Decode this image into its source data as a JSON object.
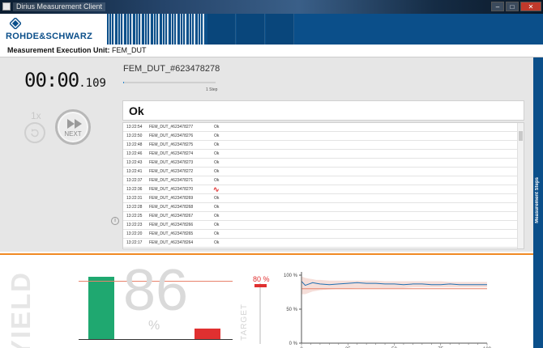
{
  "window": {
    "title": "Dirius Measurement Client",
    "minimize_glyph": "–",
    "maximize_glyph": "□",
    "close_glyph": "✕"
  },
  "header": {
    "brand": "ROHDE&SCHWARZ",
    "brand_color": "#0b4f8a"
  },
  "unit_bar": {
    "label": "Measurement Execution Unit:",
    "value": "FEM_DUT"
  },
  "timer": {
    "main": "00:00",
    "ms": ".109"
  },
  "controls": {
    "run_count": "1x",
    "next_label": "NEXT",
    "repeat_icon": "repeat-icon",
    "next_icon": "fast-forward-icon"
  },
  "current": {
    "dut_title": "FEM_DUT_#623478278",
    "progress": 0.0,
    "step_label": "1 Step",
    "status": "Ok"
  },
  "results": [
    {
      "time": "13:22:54",
      "dut": "FEM_DUT_#623478277",
      "status": "Ok",
      "fail": false
    },
    {
      "time": "13:22:50",
      "dut": "FEM_DUT_#623478276",
      "status": "Ok",
      "fail": false
    },
    {
      "time": "13:22:48",
      "dut": "FEM_DUT_#623478275",
      "status": "Ok",
      "fail": false
    },
    {
      "time": "13:22:46",
      "dut": "FEM_DUT_#623478274",
      "status": "Ok",
      "fail": false
    },
    {
      "time": "13:22:43",
      "dut": "FEM_DUT_#623478273",
      "status": "Ok",
      "fail": false
    },
    {
      "time": "13:22:41",
      "dut": "FEM_DUT_#623478272",
      "status": "Ok",
      "fail": false
    },
    {
      "time": "13:22:37",
      "dut": "FEM_DUT_#623478271",
      "status": "Ok",
      "fail": false
    },
    {
      "time": "13:22:36",
      "dut": "FEM_DUT_#623478270",
      "status": "∿",
      "fail": true
    },
    {
      "time": "13:22:31",
      "dut": "FEM_DUT_#623478269",
      "status": "Ok",
      "fail": false
    },
    {
      "time": "13:22:28",
      "dut": "FEM_DUT_#623478268",
      "status": "Ok",
      "fail": false
    },
    {
      "time": "13:22:25",
      "dut": "FEM_DUT_#623478267",
      "status": "Ok",
      "fail": false
    },
    {
      "time": "13:22:23",
      "dut": "FEM_DUT_#623478266",
      "status": "Ok",
      "fail": false
    },
    {
      "time": "13:22:20",
      "dut": "FEM_DUT_#623478265",
      "status": "Ok",
      "fail": false
    },
    {
      "time": "13:22:17",
      "dut": "FEM_DUT_#623478264",
      "status": "Ok",
      "fail": false
    }
  ],
  "side_tab": {
    "label": "Measurement Steps"
  },
  "yield": {
    "label": "YIELD",
    "value": "86",
    "unit": "%",
    "pass_fraction": 0.86,
    "fail_fraction": 0.14,
    "target_fraction": 0.8,
    "pass_color": "#1fa870",
    "fail_color": "#e03030"
  },
  "target": {
    "label": "TARGET",
    "value": "80 %"
  },
  "chart_data": {
    "type": "line",
    "x": [
      0,
      2,
      4,
      6,
      8,
      10,
      15,
      20,
      25,
      30,
      35,
      40,
      45,
      50,
      55,
      60,
      65,
      70,
      75,
      80,
      85,
      90,
      95,
      100
    ],
    "series": [
      {
        "values": [
          91,
          85,
          87,
          89,
          88,
          87,
          86,
          87,
          88,
          89,
          88,
          88,
          87,
          87,
          86,
          87,
          87,
          86,
          86,
          87,
          86,
          86,
          86,
          86
        ]
      }
    ],
    "band_upper": [
      98,
      96,
      95,
      94,
      93,
      93,
      92,
      92,
      92,
      92,
      92,
      92,
      91,
      91,
      91,
      91,
      91,
      91,
      91,
      90,
      90,
      90,
      90,
      90
    ],
    "band_lower": [
      72,
      72,
      74,
      76,
      77,
      78,
      79,
      80,
      80,
      81,
      81,
      81,
      81,
      81,
      81,
      82,
      82,
      82,
      82,
      82,
      82,
      82,
      82,
      82
    ],
    "target": 80,
    "xlim": [
      0,
      100
    ],
    "ylim": [
      0,
      100
    ],
    "x_ticks": [
      0,
      25,
      50,
      75,
      100
    ],
    "y_ticks": [
      "0 %",
      "50 %",
      "100 %"
    ],
    "line_color": "#1f6fb2",
    "band_color": "#f3d6cf",
    "target_color": "#e8826b"
  }
}
